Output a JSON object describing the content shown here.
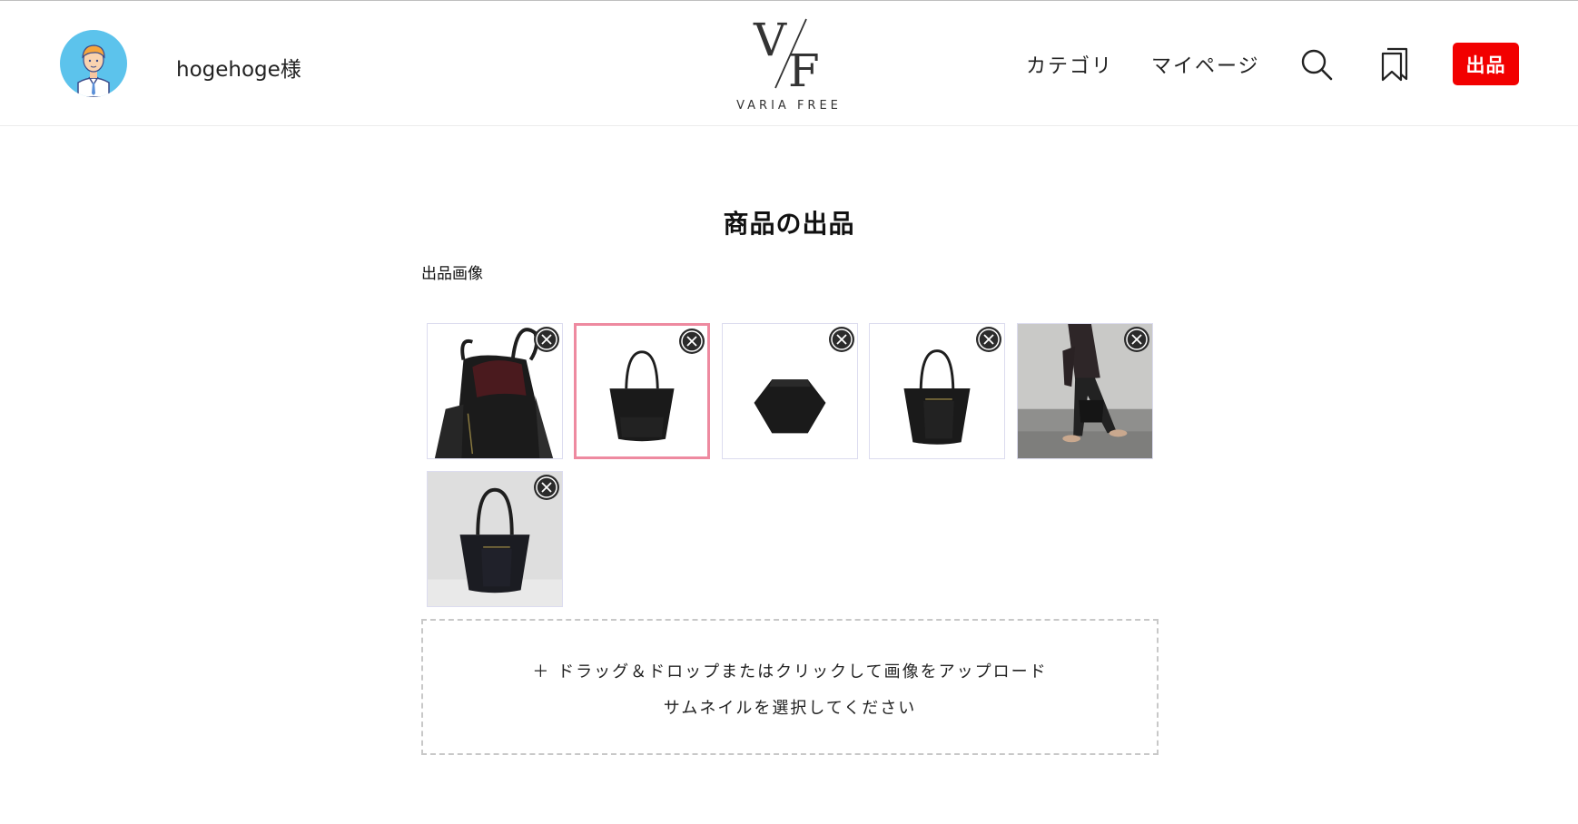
{
  "header": {
    "username": "hogehoge様",
    "logo_text": "VARIA FREE",
    "nav": {
      "category": "カテゴリ",
      "mypage": "マイページ"
    },
    "icons": {
      "search": "search-icon",
      "bookmark": "bookmark-icon"
    },
    "sell_button": "出品",
    "colors": {
      "sell_button": "#f20000",
      "avatar_bg": "#5cc3ec"
    }
  },
  "main": {
    "title": "商品の出品",
    "images_label": "出品画像",
    "images": [
      {
        "name": "tote-open-interior",
        "selected": false,
        "remove_icon": "close-circle-icon"
      },
      {
        "name": "tote-front",
        "selected": true,
        "remove_icon": "close-circle-icon"
      },
      {
        "name": "tote-bottom",
        "selected": false,
        "remove_icon": "close-circle-icon"
      },
      {
        "name": "tote-back",
        "selected": false,
        "remove_icon": "close-circle-icon"
      },
      {
        "name": "tote-model-walking",
        "selected": false,
        "remove_icon": "close-circle-icon"
      },
      {
        "name": "tote-front-grey-bg",
        "selected": false,
        "remove_icon": "close-circle-icon"
      }
    ],
    "selected_border_color": "#ee8aa0",
    "dropzone": {
      "line1": "＋ ドラッグ＆ドロップまたはクリックして画像をアップロード",
      "line2": "サムネイルを選択してください"
    }
  }
}
